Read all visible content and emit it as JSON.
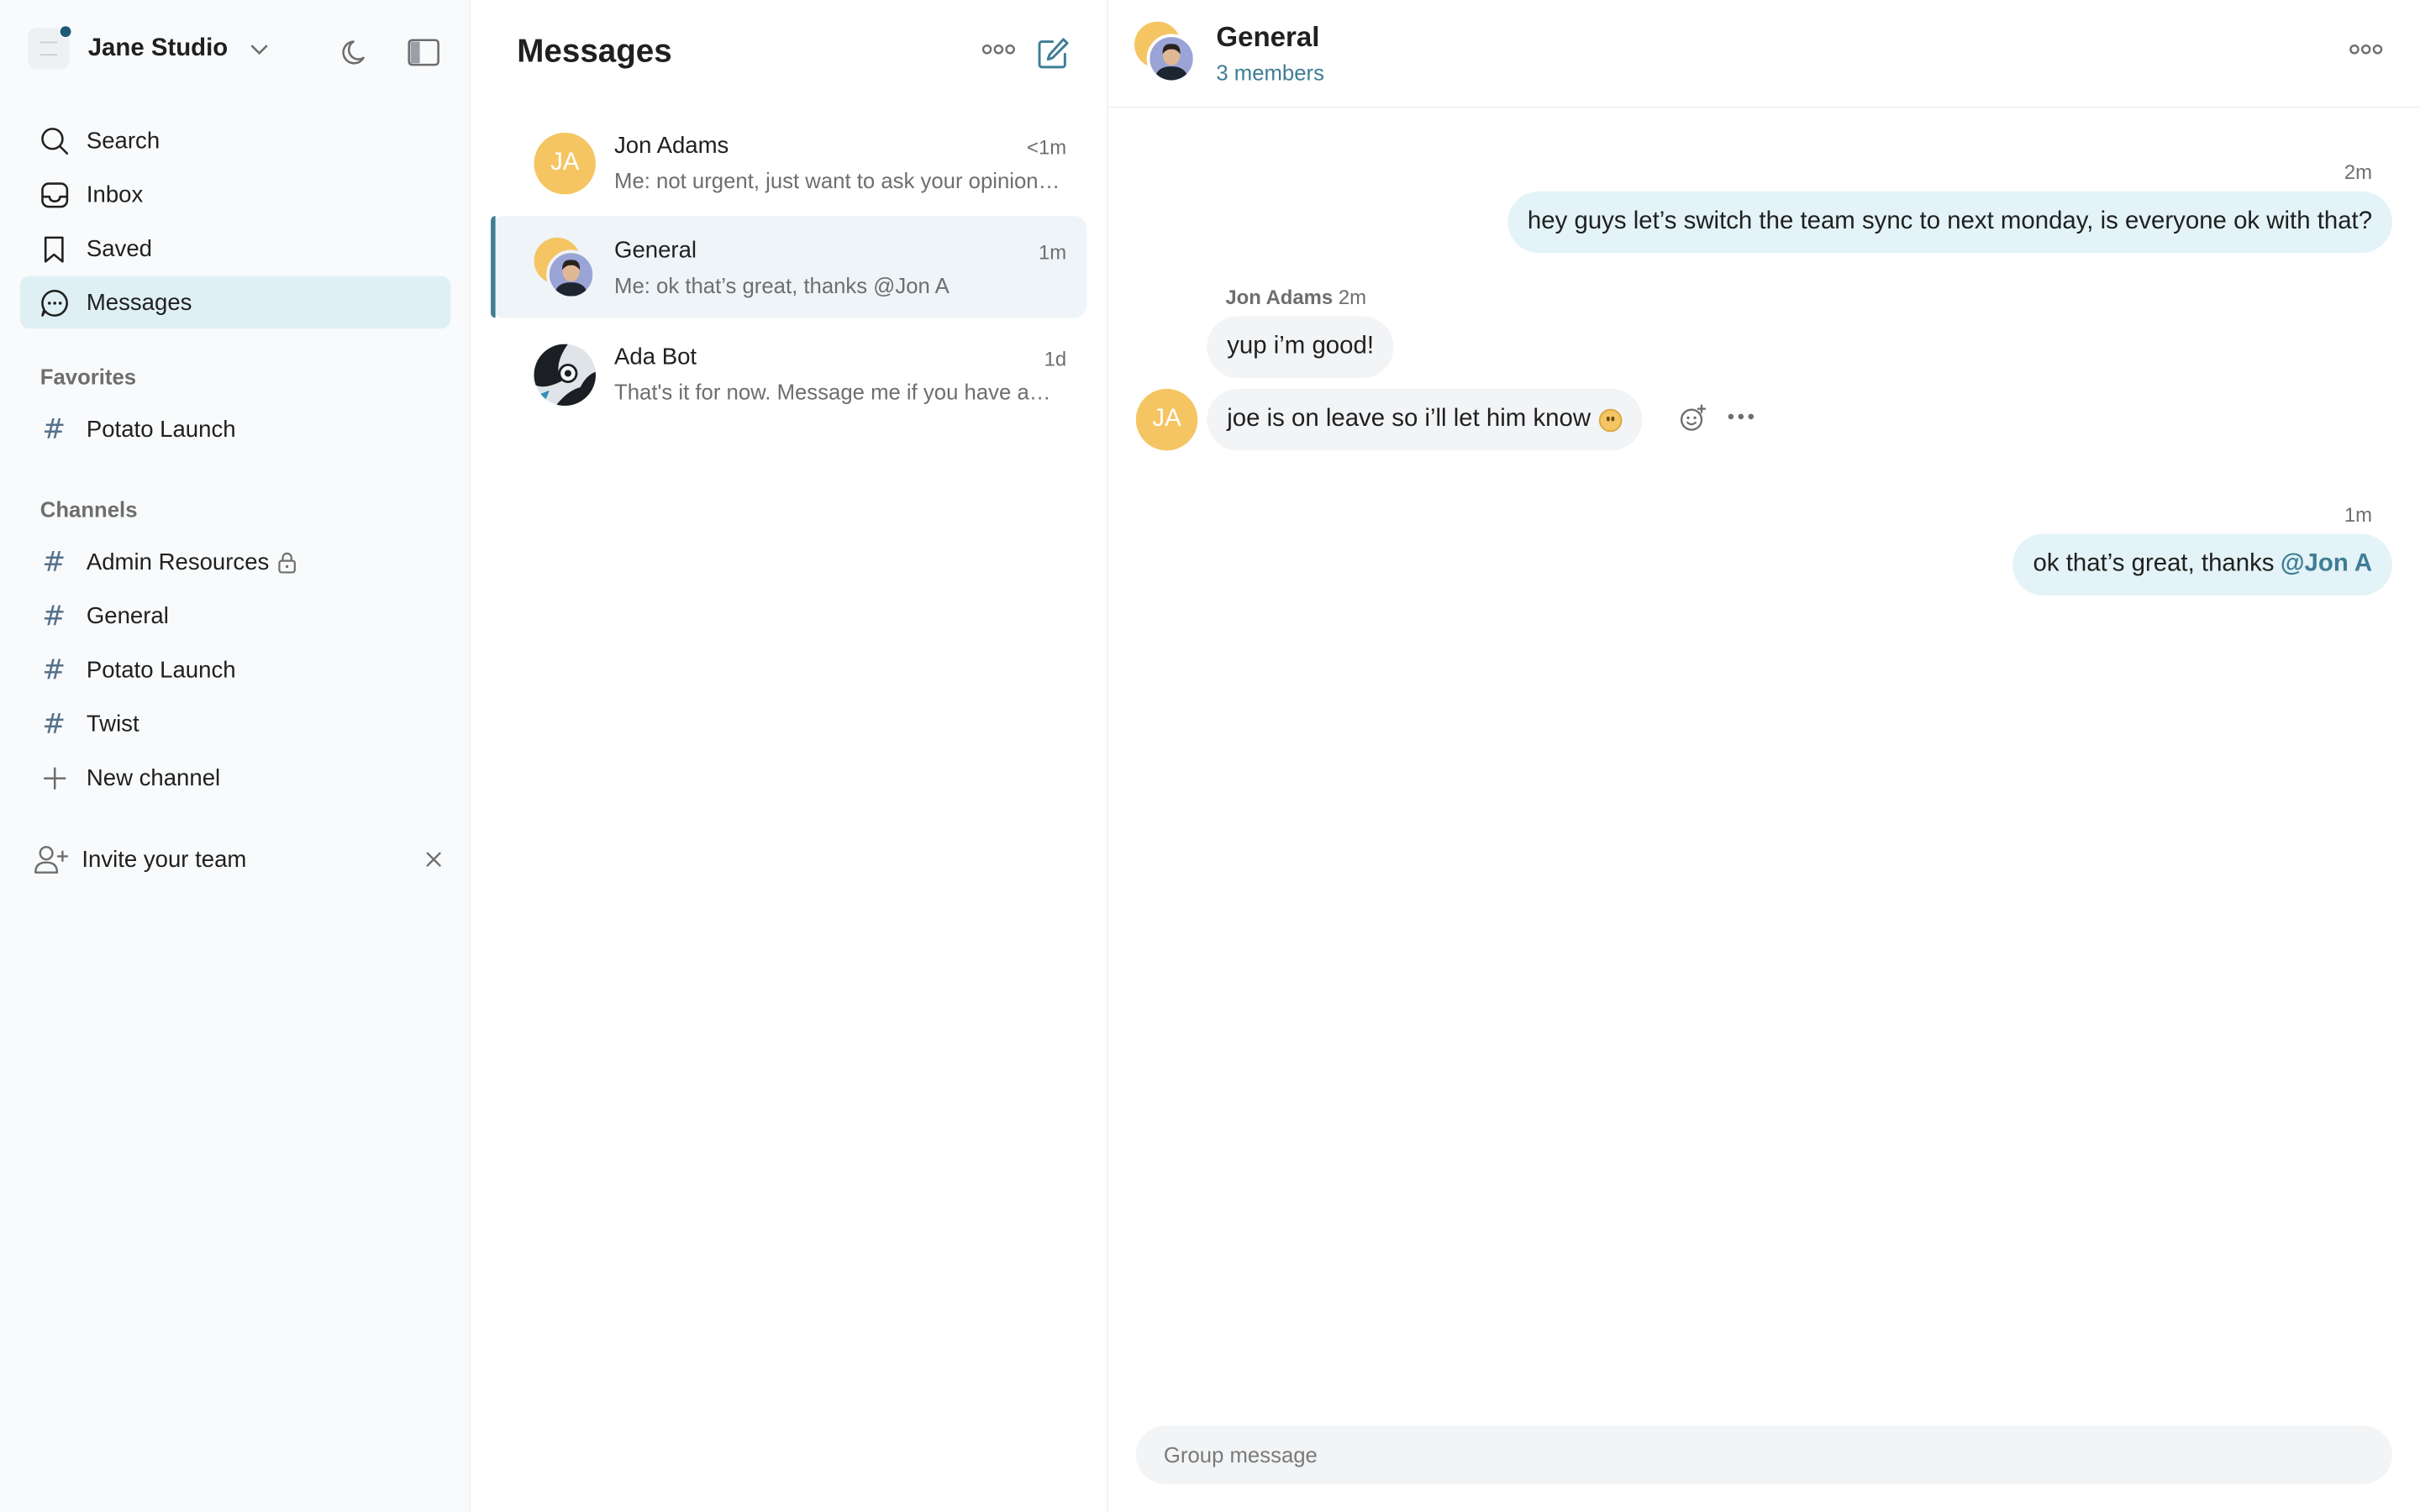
{
  "workspace": {
    "name": "Jane Studio"
  },
  "sidebar": {
    "nav": [
      {
        "label": "Search",
        "icon": "search-icon"
      },
      {
        "label": "Inbox",
        "icon": "inbox-icon"
      },
      {
        "label": "Saved",
        "icon": "bookmark-icon"
      },
      {
        "label": "Messages",
        "icon": "chat-bubble-icon",
        "active": true
      }
    ],
    "favorites_title": "Favorites",
    "favorites": [
      {
        "label": "Potato Launch"
      }
    ],
    "channels_title": "Channels",
    "channels": [
      {
        "label": "Admin Resources",
        "locked": true
      },
      {
        "label": "General"
      },
      {
        "label": "Potato Launch"
      },
      {
        "label": "Twist"
      }
    ],
    "new_channel": "New channel",
    "invite": "Invite your team"
  },
  "messages_list": {
    "title": "Messages",
    "conversations": [
      {
        "name": "Jon Adams",
        "time": "<1m",
        "preview": "Me: not urgent, just want to ask your opinion on something",
        "initials": "JA"
      },
      {
        "name": "General",
        "time": "1m",
        "preview": "Me: ok that’s great, thanks @Jon A",
        "active": true
      },
      {
        "name": "Ada Bot",
        "time": "1d",
        "preview": "That's it for now. Message me if you have any questions!"
      }
    ]
  },
  "chat": {
    "title": "General",
    "subtitle": "3 members",
    "messages": [
      {
        "time": "2m",
        "text": "hey guys let’s switch the team sync to next monday, is everyone ok with that?"
      },
      {
        "sender": "Jon Adams",
        "time": "2m",
        "text": "yup i’m good!"
      },
      {
        "text": "joe is on leave so i’ll let him know",
        "initials": "JA"
      },
      {
        "time": "1m",
        "text": "ok that’s great, thanks",
        "mention": "@Jon A"
      }
    ],
    "composer_placeholder": "Group message"
  },
  "colors": {
    "accent": "#3f7d95",
    "active_nav": "#dff0f5",
    "avatar_yellow": "#f5c563",
    "my_bubble": "#e3f3f7"
  }
}
